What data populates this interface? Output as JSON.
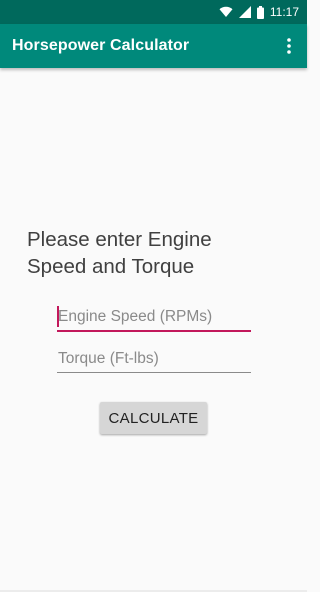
{
  "status_bar": {
    "time": "11:17",
    "icons": [
      "wifi-icon",
      "signal-icon",
      "battery-icon"
    ]
  },
  "app_bar": {
    "title": "Horsepower Calculator",
    "overflow_icon": "more-vert-icon"
  },
  "main": {
    "prompt_line1": "Please enter Engine",
    "prompt_line2": "Speed and Torque",
    "engine_speed_placeholder": "Engine Speed (RPMs)",
    "torque_placeholder": "Torque (Ft-lbs)",
    "calculate_label": "CALCULATE"
  },
  "colors": {
    "status_bar": "#00695c",
    "app_bar": "#00897b",
    "accent": "#c2185b",
    "button": "#d6d6d6"
  }
}
